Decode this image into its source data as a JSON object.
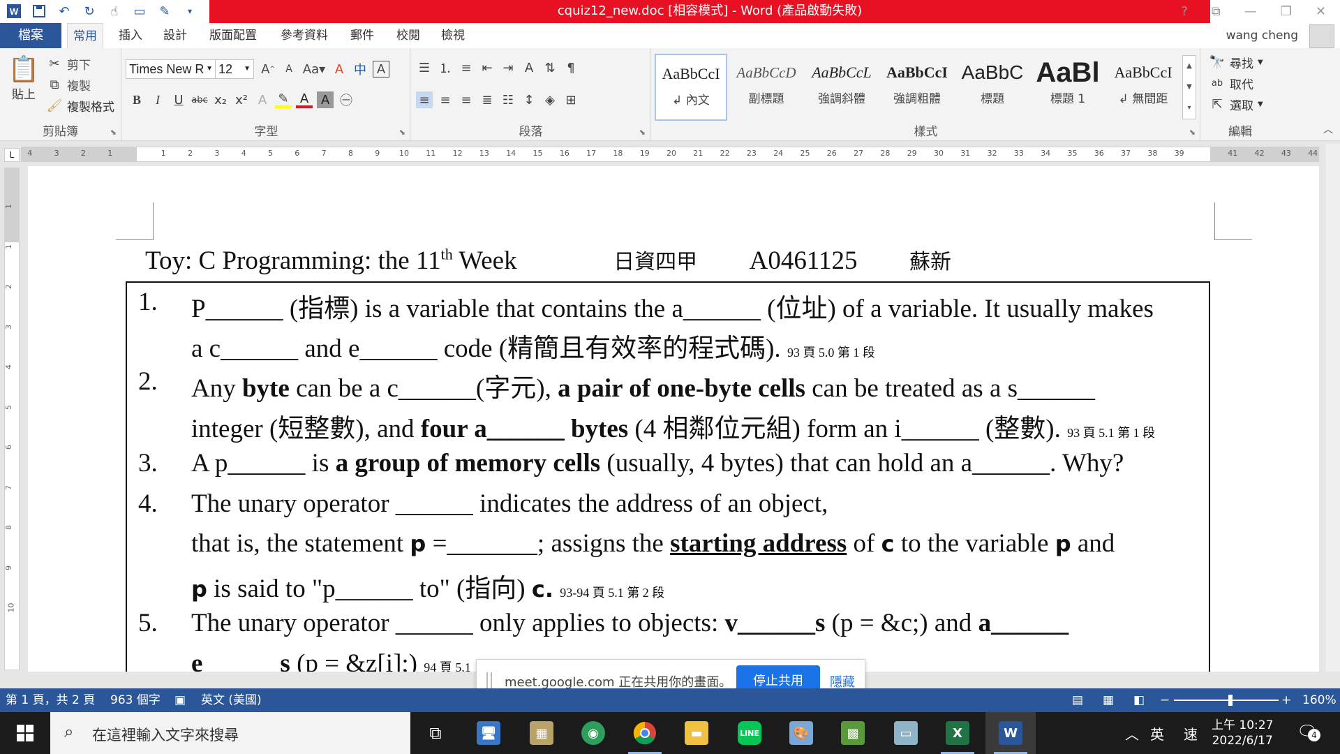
{
  "window": {
    "title": "cquiz12_new.doc [相容模式] - Word (產品啟動失敗)"
  },
  "tabs": [
    {
      "label": "檔案"
    },
    {
      "label": "常用"
    },
    {
      "label": "插入"
    },
    {
      "label": "設計"
    },
    {
      "label": "版面配置"
    },
    {
      "label": "參考資料"
    },
    {
      "label": "郵件"
    },
    {
      "label": "校閱"
    },
    {
      "label": "檢視"
    }
  ],
  "user": {
    "name": "wang cheng"
  },
  "ribbon": {
    "clipboard": {
      "paste": "貼上",
      "cut": "剪下",
      "copy": "複製",
      "format_painter": "複製格式",
      "label": "剪貼簿"
    },
    "font": {
      "name": "Times New R",
      "size": "12",
      "label": "字型"
    },
    "paragraph": {
      "label": "段落"
    },
    "styles": {
      "label": "樣式",
      "items": [
        {
          "sample": "AaBbCcI",
          "name": "↲ 內文"
        },
        {
          "sample": "AaBbCcD",
          "name": "副標題"
        },
        {
          "sample": "AaBbCcL",
          "name": "強調斜體"
        },
        {
          "sample": "AaBbCcI",
          "name": "強調粗體"
        },
        {
          "sample": "AaBbC",
          "name": "標題"
        },
        {
          "sample": "AaBl",
          "name": "標題 1"
        },
        {
          "sample": "AaBbCcI",
          "name": "↲ 無間距"
        }
      ]
    },
    "editing": {
      "find": "尋找",
      "replace": "取代",
      "select": "選取",
      "label": "編輯"
    }
  },
  "ruler": {
    "left_numbers": [
      "4",
      "3",
      "2",
      "1"
    ],
    "right_numbers": [
      "1",
      "2",
      "3",
      "4",
      "5",
      "6",
      "7",
      "8",
      "9",
      "10",
      "11",
      "12",
      "13",
      "14",
      "15",
      "16",
      "17",
      "18",
      "19",
      "20",
      "21",
      "22",
      "23",
      "24",
      "25",
      "26",
      "27",
      "28",
      "29",
      "30",
      "31",
      "32",
      "33",
      "34",
      "35",
      "36",
      "37",
      "38",
      "39"
    ],
    "margin_numbers": [
      "41",
      "42",
      "43",
      "44"
    ]
  },
  "vruler": {
    "numbers": [
      "1",
      "1",
      "2",
      "3",
      "4",
      "5",
      "6",
      "7",
      "8",
      "9",
      "10"
    ]
  },
  "document": {
    "heading_main": "Toy: C Programming: the 11",
    "heading_sup": "th",
    "heading_week": " Week",
    "heading_class": "日資四甲",
    "heading_id": "A0461125",
    "heading_name": "蘇新",
    "q1_num": "1.",
    "q1_l1": "P______ (指標) is a variable that contains the a______ (位址) of a variable. It usually makes",
    "q1_l2": "a c______ and e______ code (精簡且有效率的程式碼).",
    "q1_note": "93 頁 5.0 第 1 段",
    "q2_num": "2.",
    "q2_l1a": "Any ",
    "q2_l1b": "byte",
    "q2_l1c": " can be a c______(字元), ",
    "q2_l1d": "a pair of one-byte cells",
    "q2_l1e": " can be treated as a s______",
    "q2_l2a": "integer (短整數), and ",
    "q2_l2b": "four a______ bytes",
    "q2_l2c": " (4 相鄰位元組) form an i______ (整數).",
    "q2_note": "93 頁 5.1 第 1 段",
    "q3_num": "3.",
    "q3_a": "A p______ is ",
    "q3_b": "a group of memory cells",
    "q3_c": " (usually, 4 bytes) that can hold an a______. Why?",
    "q4_num": "4.",
    "q4_l1": "The unary operator ______ indicates the address of an object,",
    "q4_l2a": "that is, the statement ",
    "q4_l2p": "p",
    "q4_l2b": " =_______; assigns the ",
    "q4_l2c": "starting address",
    "q4_l2d": " of ",
    "q4_l2e": "c",
    "q4_l2f": " to the variable ",
    "q4_l2g": "p",
    "q4_l2h": " and",
    "q4_l3a": "p",
    "q4_l3b": " is said to \"p______ to\" (指向) ",
    "q4_l3c": "c.",
    "q4_note": "93-94 頁 5.1 第 2 段",
    "q5_num": "5.",
    "q5_a": "The unary operator ______ only applies to objects: ",
    "q5_b": "v______s",
    "q5_c": " (p = &c;) and ",
    "q5_d": "a______",
    "q5_l2a": "e______s",
    "q5_l2b": " (p = &z[i];)",
    "q5_note": "94 頁 5.1"
  },
  "share": {
    "text": "meet.google.com 正在共用你的畫面。",
    "stop": "停止共用",
    "hide": "隱藏"
  },
  "status": {
    "page": "第 1 頁，共 2 頁",
    "words": "963 個字",
    "lang": "英文 (美國)",
    "zoom": "160%"
  },
  "taskbar": {
    "search_placeholder": "在這裡輸入文字來搜尋",
    "ime1": "英",
    "ime2": "速",
    "time": "上午 10:27",
    "date": "2022/6/17",
    "notif_count": "4"
  },
  "colors": {
    "word_blue": "#2b579a",
    "title_red": "#e81123",
    "meet_blue": "#1a73e8"
  }
}
